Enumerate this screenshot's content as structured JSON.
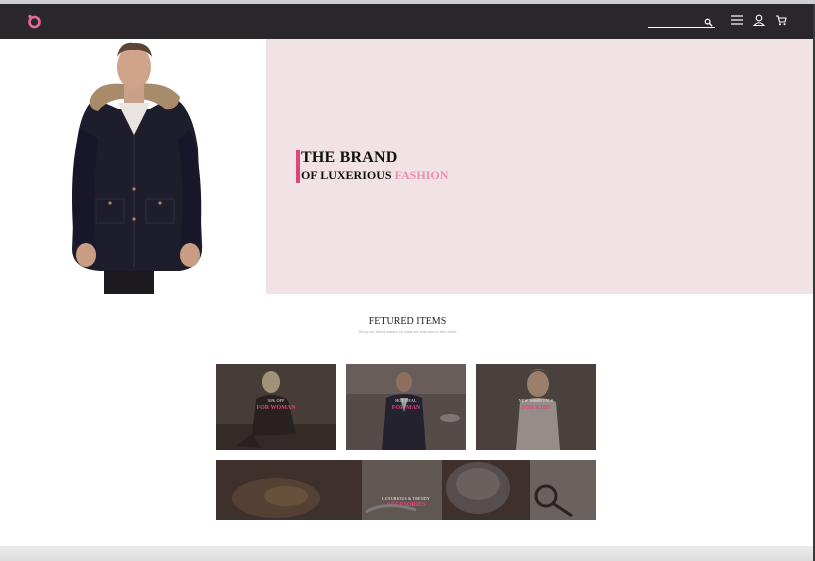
{
  "header": {
    "logo_icon": "brand-logo-icon",
    "search": {
      "placeholder": "",
      "icon": "search-icon"
    },
    "icons": [
      "menu-icon",
      "user-icon",
      "cart-icon"
    ]
  },
  "hero": {
    "title": "THE BRAND",
    "subtitle_main": "OF LUXERIOUS ",
    "subtitle_accent": "FASHION",
    "accent_color": "#ee8fab",
    "bar_color": "#e0457a",
    "background": "#f0e2e5"
  },
  "featured": {
    "title": "FETURED ITEMS",
    "subtitle": "Shop our items based on what we featured in this week",
    "tiles": [
      {
        "caption": "30% OFF",
        "label": "FOR WOMAN"
      },
      {
        "caption": "HOT DEAL",
        "label": "FOR MAN"
      },
      {
        "caption": "NEW ARRRIVALS",
        "label": "FOR KIDS"
      },
      {
        "caption": "LUXURIOUS & TRENDY",
        "label": "ACCESORIES"
      }
    ]
  }
}
